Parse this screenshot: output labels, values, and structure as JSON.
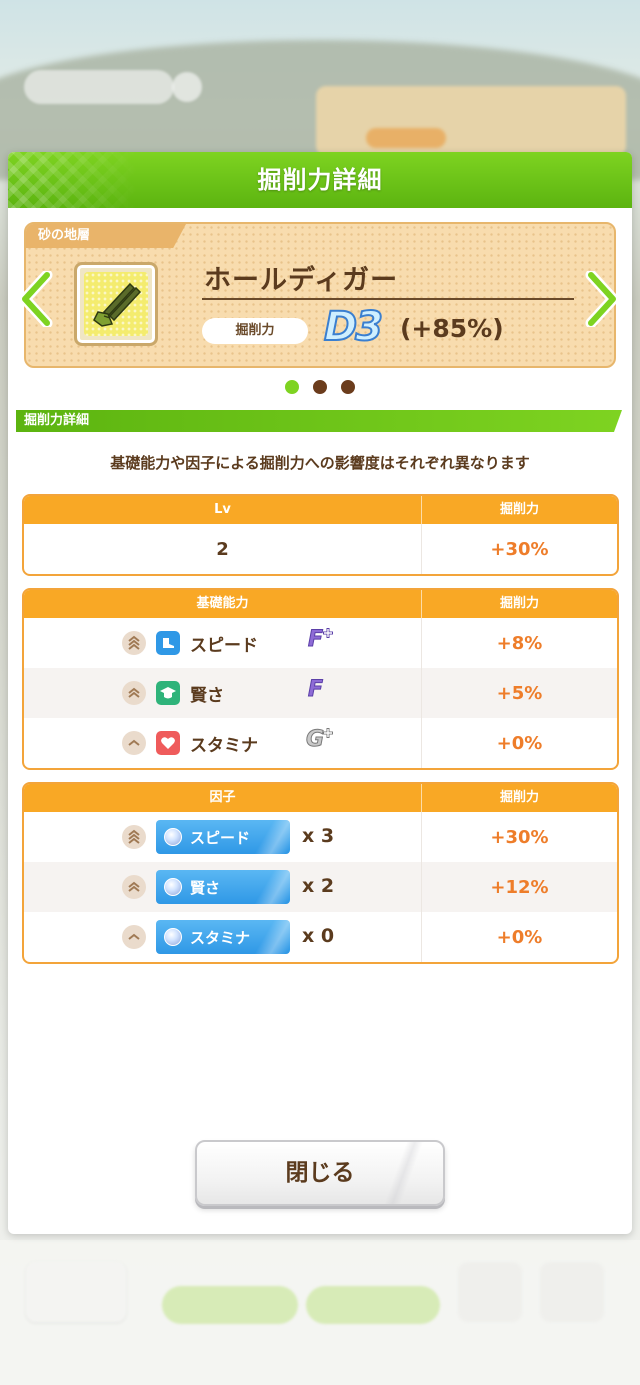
{
  "dialog": {
    "title": "掘削力詳細",
    "item": {
      "terrain_tag": "砂の地層",
      "name": "ホールディガー",
      "stat_label": "掘削力",
      "rank": "D3",
      "rank_bonus": "(+85%)"
    },
    "carousel": {
      "total": 3,
      "active": 1
    },
    "section_title": "掘削力詳細",
    "description": "基礎能力や因子による掘削力への影響度はそれぞれ異なります",
    "level_table": {
      "header": "Lv",
      "header_value": "掘削力",
      "level": "2",
      "value": "+30%"
    },
    "stats_table": {
      "header": "基礎能力",
      "header_value": "掘削力",
      "rows": [
        {
          "icon": "speed-shoe-icon",
          "label": "スピード",
          "grade": "F",
          "grade_plus": true,
          "value": "+8%",
          "chevron": "triple"
        },
        {
          "icon": "wisdom-cap-icon",
          "label": "賢さ",
          "grade": "F",
          "grade_plus": false,
          "value": "+5%",
          "chevron": "double"
        },
        {
          "icon": "stamina-heart-icon",
          "label": "スタミナ",
          "grade": "G",
          "grade_plus": true,
          "value": "+0%",
          "chevron": "single"
        }
      ]
    },
    "factor_table": {
      "header": "因子",
      "header_value": "掘削力",
      "rows": [
        {
          "label": "スピード",
          "count": "x 3",
          "value": "+30%",
          "chevron": "triple"
        },
        {
          "label": "賢さ",
          "count": "x 2",
          "value": "+12%",
          "chevron": "double"
        },
        {
          "label": "スタミナ",
          "count": "x 0",
          "value": "+0%",
          "chevron": "single"
        }
      ]
    },
    "close_label": "閉じる"
  },
  "colors": {
    "header_green": "#5cb410",
    "table_orange": "#f9a825",
    "value_orange": "#ee7d2a",
    "text_brown": "#5b3b1e",
    "grade_purple": "#8e6bd6",
    "grade_gray": "#9a9a9a",
    "factor_blue": "#2f98e6"
  }
}
